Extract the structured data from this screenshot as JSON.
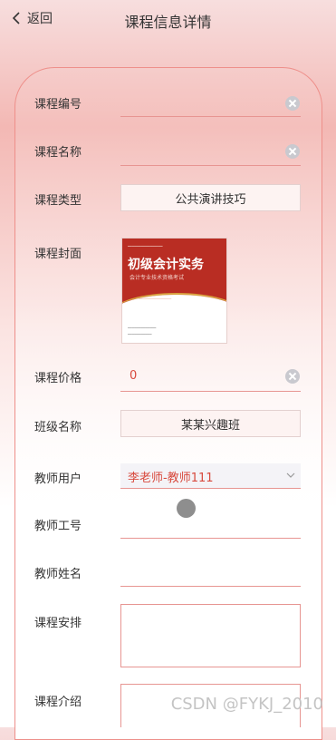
{
  "header": {
    "back_label": "返回",
    "title": "课程信息详情"
  },
  "form": {
    "course_code": {
      "label": "课程编号",
      "value": ""
    },
    "course_name": {
      "label": "课程名称",
      "value": ""
    },
    "course_type": {
      "label": "课程类型",
      "value": "公共演讲技巧"
    },
    "cover": {
      "label": "课程封面",
      "image_title": "初级会计实务",
      "image_subtitle": "会计专业技术资格考试"
    },
    "price": {
      "label": "课程价格",
      "value": "0"
    },
    "class_name": {
      "label": "班级名称",
      "value": "某某兴趣班"
    },
    "teacher_user": {
      "label": "教师用户",
      "value": "李老师-教师111"
    },
    "teacher_id": {
      "label": "教师工号",
      "value": ""
    },
    "teacher_name": {
      "label": "教师姓名",
      "value": ""
    },
    "schedule": {
      "label": "课程安排",
      "value": ""
    },
    "intro": {
      "label": "课程介绍",
      "value": ""
    }
  },
  "watermark": "CSDN @FYKJ_2010",
  "colors": {
    "accent": "#d84a3e",
    "border": "#e79592",
    "background_pink": "#f3b8b4"
  },
  "icons": [
    "chevron-left-icon",
    "clear-icon",
    "chevron-down-icon"
  ]
}
